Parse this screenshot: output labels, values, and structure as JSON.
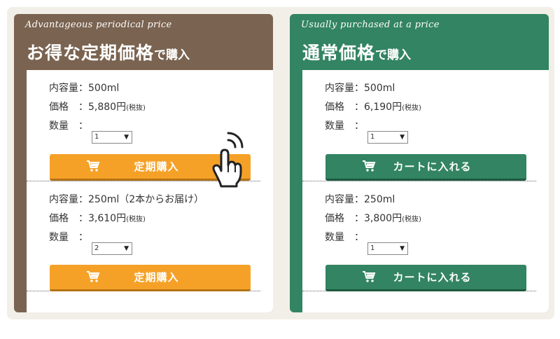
{
  "periodic": {
    "script_title": "Advantageous periodical price",
    "title_main": "お得な定期価格",
    "title_suffix": "で購入",
    "items": [
      {
        "capacity_label": "内容量：",
        "capacity_value": "500ml",
        "price_label": "価格　：",
        "price_value": "5,880円",
        "tax_note": "(税抜)",
        "qty_label": "数量　：",
        "qty_value": "1",
        "button_label": "定期購入"
      },
      {
        "capacity_label": "内容量：",
        "capacity_value": "250ml（2本からお届け）",
        "price_label": "価格　：",
        "price_value": "3,610円",
        "tax_note": "(税抜)",
        "qty_label": "数量　：",
        "qty_value": "2",
        "button_label": "定期購入"
      }
    ],
    "color": "#7a6350",
    "button_color": "#f5a128"
  },
  "normal": {
    "script_title": "Usually purchased at a price",
    "title_main": "通常価格",
    "title_suffix": "で購入",
    "items": [
      {
        "capacity_label": "内容量：",
        "capacity_value": "500ml",
        "price_label": "価格　：",
        "price_value": "6,190円",
        "tax_note": "(税抜)",
        "qty_label": "数量　：",
        "qty_value": "1",
        "button_label": "カートに入れる"
      },
      {
        "capacity_label": "内容量：",
        "capacity_value": "250ml",
        "price_label": "価格　：",
        "price_value": "3,800円",
        "tax_note": "(税抜)",
        "qty_label": "数量　：",
        "qty_value": "1",
        "button_label": "カートに入れる"
      }
    ],
    "color": "#338462",
    "button_color": "#338462"
  },
  "icons": {
    "cart": "cart-icon",
    "cursor": "pointer-hand-icon",
    "dropdown": "chevron-down-icon"
  }
}
